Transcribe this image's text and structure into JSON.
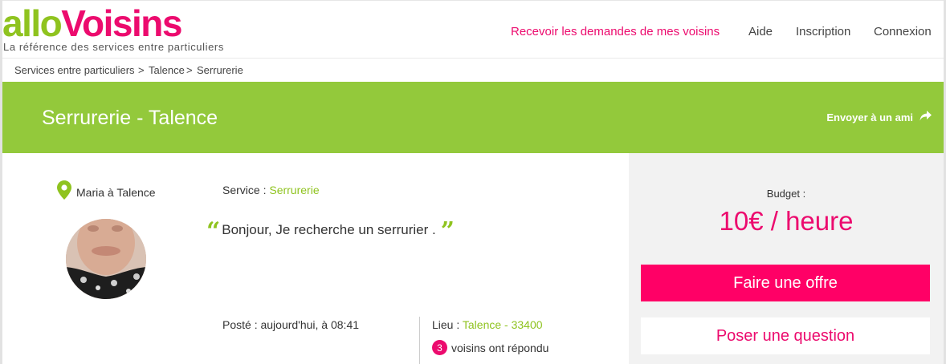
{
  "logo": {
    "part1": "allo",
    "part2": "Voisins",
    "tagline": "La référence des services entre particuliers"
  },
  "nav": {
    "receive_requests": "Recevoir les demandes de mes voisins",
    "help": "Aide",
    "signup": "Inscription",
    "login": "Connexion"
  },
  "breadcrumb": {
    "items": [
      "Services entre particuliers",
      "Talence",
      "Serrurerie"
    ],
    "separator": ">"
  },
  "banner": {
    "title": "Serrurerie - Talence",
    "share": "Envoyer à un ami"
  },
  "request": {
    "location_label": "Maria à Talence",
    "service_label": "Service :",
    "service_value": "Serrurerie",
    "message": "Bonjour, Je recherche un serrurier .",
    "posted": "Posté : aujourd'hui, à 08:41",
    "lieu_label": "Lieu :",
    "lieu_value": "Talence - 33400",
    "reply_count": "3",
    "reply_text": "voisins ont répondu"
  },
  "sidebar": {
    "budget_label": "Budget :",
    "budget_value": "10€ / heure",
    "offer_button": "Faire une offre",
    "question_button": "Poser une question"
  },
  "colors": {
    "green": "#93c93b",
    "pink": "#ec0b6e",
    "button_pink": "#ff0066"
  },
  "icons": [
    "location-pin-icon",
    "share-arrow-icon",
    "quote-open-icon",
    "quote-close-icon"
  ]
}
